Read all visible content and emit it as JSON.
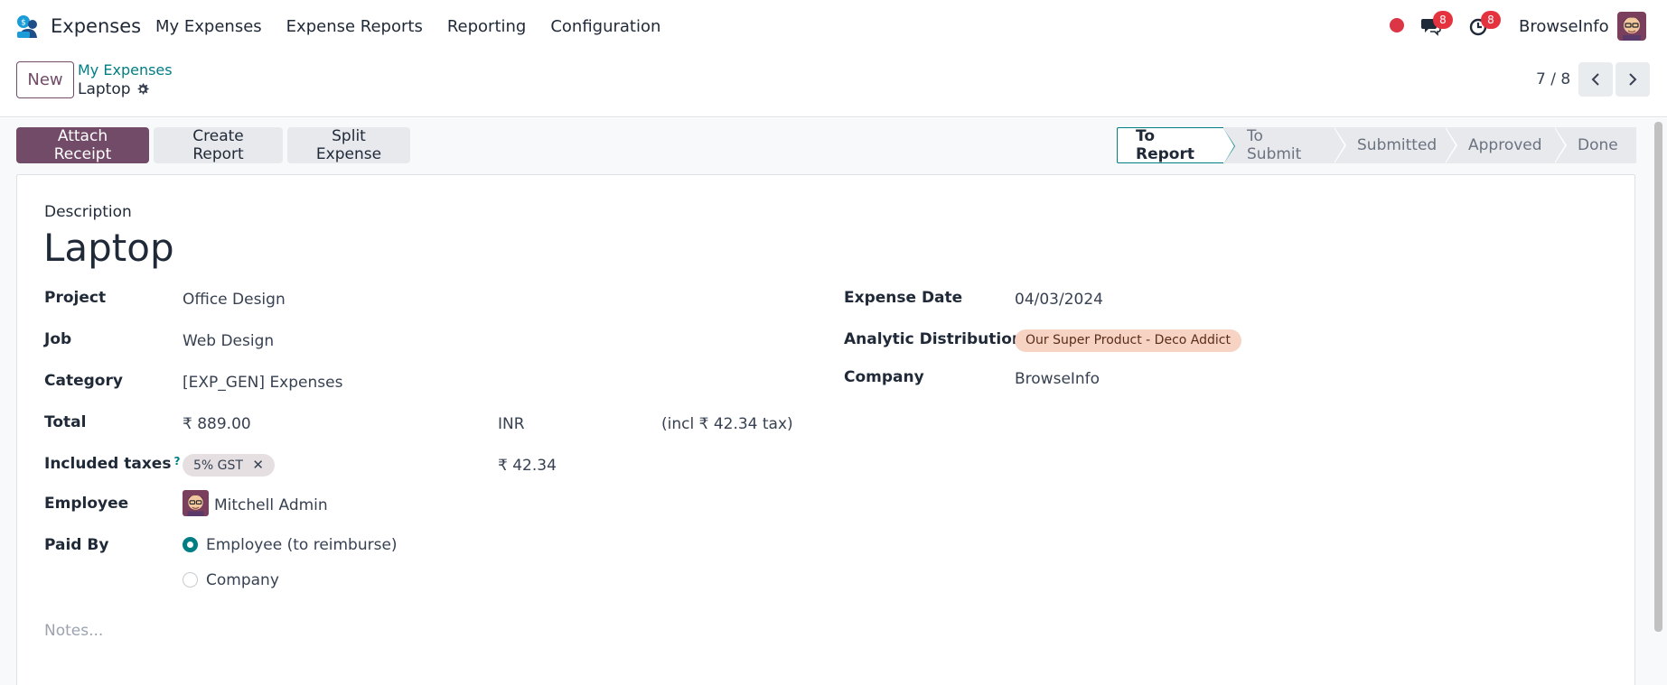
{
  "navbar": {
    "app_name": "Expenses",
    "menu": [
      "My Expenses",
      "Expense Reports",
      "Reporting",
      "Configuration"
    ],
    "messages_count": "8",
    "activities_count": "8",
    "company": "BrowseInfo"
  },
  "control": {
    "new_label": "New",
    "breadcrumb_parent": "My Expenses",
    "breadcrumb_current": "Laptop",
    "pager": "7 / 8"
  },
  "actions": {
    "attach_receipt": "Attach Receipt",
    "create_report": "Create Report",
    "split_expense": "Split Expense"
  },
  "status": {
    "stages": [
      "To Report",
      "To Submit",
      "Submitted",
      "Approved",
      "Done"
    ],
    "active": "To Report"
  },
  "form": {
    "description_label": "Description",
    "title": "Laptop",
    "project_label": "Project",
    "project": "Office Design",
    "job_label": "Job",
    "job": "Web Design",
    "category_label": "Category",
    "category": "[EXP_GEN] Expenses",
    "total_label": "Total",
    "total": "₹ 889.00",
    "currency": "INR",
    "tax_note": "(incl ₹ 42.34 tax)",
    "included_taxes_label": "Included taxes",
    "tax_help": "?",
    "tax_tag": "5% GST",
    "tax_amount": "₹ 42.34",
    "employee_label": "Employee",
    "employee": "Mitchell Admin",
    "paid_by_label": "Paid By",
    "paid_by_options": [
      "Employee (to reimburse)",
      "Company"
    ],
    "paid_by_selected": "Employee (to reimburse)",
    "expense_date_label": "Expense Date",
    "expense_date": "04/03/2024",
    "analytic_label": "Analytic Distribution",
    "analytic": "Our Super Product - Deco Addict",
    "company_label": "Company",
    "company": "BrowseInfo",
    "notes_placeholder": "Notes..."
  },
  "colors": {
    "brand": "#714b67",
    "accent": "#017e84",
    "badge": "#e5323f"
  }
}
